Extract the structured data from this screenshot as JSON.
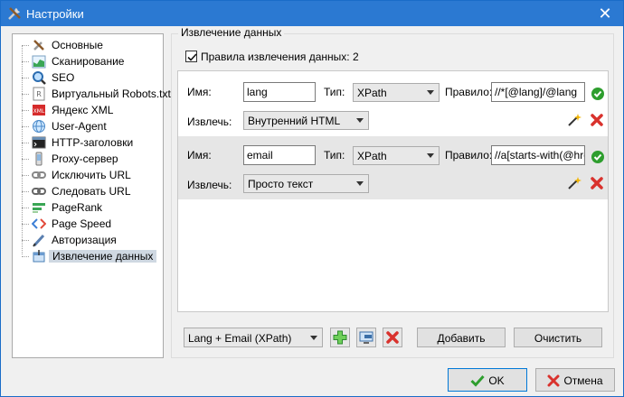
{
  "window": {
    "title": "Настройки"
  },
  "sidebar": {
    "items": [
      {
        "label": "Основные",
        "icon": "tools-icon"
      },
      {
        "label": "Сканирование",
        "icon": "chart-icon"
      },
      {
        "label": "SEO",
        "icon": "magnifier-icon"
      },
      {
        "label": "Виртуальный Robots.txt",
        "icon": "robots-icon"
      },
      {
        "label": "Яндекс XML",
        "icon": "xml-icon"
      },
      {
        "label": "User-Agent",
        "icon": "globe-icon"
      },
      {
        "label": "HTTP-заголовки",
        "icon": "terminal-icon"
      },
      {
        "label": "Proxy-сервер",
        "icon": "phone-icon"
      },
      {
        "label": "Исключить URL",
        "icon": "link-exclude-icon"
      },
      {
        "label": "Следовать URL",
        "icon": "link-follow-icon"
      },
      {
        "label": "PageRank",
        "icon": "pagerank-icon"
      },
      {
        "label": "Page Speed",
        "icon": "code-icon"
      },
      {
        "label": "Авторизация",
        "icon": "pen-icon"
      },
      {
        "label": "Извлечение данных",
        "icon": "extract-icon"
      }
    ],
    "selected": "Извлечение данных"
  },
  "main": {
    "group_title": "Извлечение данных",
    "enable_label": "Правила извлечения данных: 2",
    "enable_checked": true,
    "labels": {
      "name": "Имя:",
      "type": "Тип:",
      "rule": "Правило:",
      "extract": "Извлечь:"
    },
    "rules": [
      {
        "name": "lang",
        "type": "XPath",
        "rule": "//*[@lang]/@lang",
        "extract": "Внутренний HTML"
      },
      {
        "name": "email",
        "type": "XPath",
        "rule": "//a[starts-with(@href",
        "extract": "Просто текст"
      }
    ],
    "preset": "Lang + Email (XPath)",
    "add_label": "Добавить",
    "clear_label": "Очистить"
  },
  "footer": {
    "ok_label": "OK",
    "cancel_label": "Отмена"
  },
  "colors": {
    "titlebar": "#2b79d2",
    "ok_green": "#2e9e2e",
    "delete_red": "#d9322d"
  }
}
